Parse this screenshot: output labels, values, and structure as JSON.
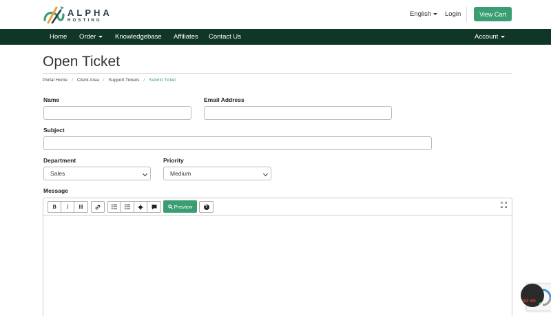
{
  "brand": {
    "name": "ALPHA",
    "tagline": "HOSTING",
    "accent": "#3b9e72",
    "nav_bg": "#0f3626",
    "icon": "alpha-logo-icon"
  },
  "header": {
    "language": "English",
    "login": "Login",
    "cart": "View Cart"
  },
  "nav": {
    "home": "Home",
    "order": "Order",
    "knowledgebase": "Knowledgebase",
    "affiliates": "Affiliates",
    "contact": "Contact Us",
    "account": "Account"
  },
  "page": {
    "title": "Open Ticket"
  },
  "breadcrumb": [
    "Portal Home",
    "Client Area",
    "Support Tickets",
    "Submit Ticket"
  ],
  "form": {
    "name_label": "Name",
    "name_value": "",
    "email_label": "Email Address",
    "email_value": "",
    "subject_label": "Subject",
    "subject_value": "",
    "department_label": "Department",
    "department_value": "Sales",
    "priority_label": "Priority",
    "priority_value": "Medium",
    "message_label": "Message"
  },
  "editor": {
    "bold": "B",
    "italic": "I",
    "heading": "H",
    "preview": "Preview",
    "help": "?",
    "icons": [
      "bold-icon",
      "italic-icon",
      "heading-icon",
      "link-icon",
      "unordered-list-icon",
      "ordered-list-icon",
      "image-icon",
      "quote-icon",
      "search-icon",
      "help-icon",
      "fullscreen-icon"
    ]
  },
  "widget": {
    "badge_text": "GO VO"
  }
}
